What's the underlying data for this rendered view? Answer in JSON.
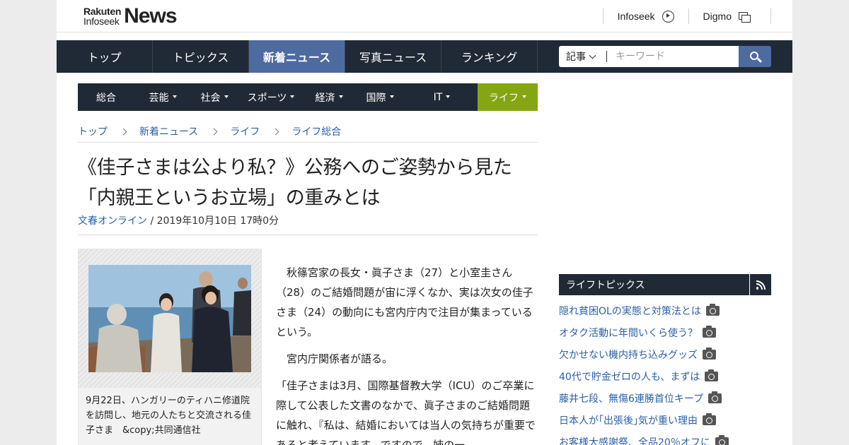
{
  "header": {
    "logo_small_1": "Rakuten",
    "logo_small_2": "Infoseek",
    "logo_big": "News",
    "links": [
      {
        "label": "Infoseek",
        "icon": "circle-arrow-icon"
      },
      {
        "label": "Digmo",
        "icon": "window-icon"
      }
    ]
  },
  "mainnav": {
    "items": [
      "トップ",
      "トピックス",
      "新着ニュース",
      "写真ニュース",
      "ランキング"
    ],
    "active": "新着ニュース"
  },
  "search": {
    "select_value": "記事",
    "placeholder": "キーワード"
  },
  "catnav": {
    "items": [
      "総合",
      "芸能",
      "社会",
      "スポーツ",
      "経済",
      "国際",
      "IT",
      "ライフ"
    ],
    "active": "ライフ",
    "active_color": "#85a613"
  },
  "breadcrumb": [
    "トップ",
    "新着ニュース",
    "ライフ",
    "ライフ総合"
  ],
  "article": {
    "title": "《佳子さまは公より私？》公務へのご姿勢から見た「内親王というお立場」の重みとは",
    "source": "文春オンライン",
    "date": "/ 2019年10月10日 17時0分",
    "caption": "9月22日、ハンガリーのティハニ修道院を訪問し、地元の人たちと交流される佳子さま　&copy;共同通信社",
    "paragraphs": [
      "秋篠宮家の長女・眞子さま（27）と小室圭さん（28）のご結婚問題が宙に浮くなか、実は次女の佳子さま（24）の動向にも宮内庁内で注目が集まっているという。",
      "宮内庁関係者が語る。",
      "「佳子さまは3月、国際基督教大学（ICU）のご卒業に際して公表した文書のなかで、眞子さまのご結婚問題に触れ、『私は、結婚においては当人の気持ちが重要であると考えています。ですので、姉の一"
    ]
  },
  "sidebar": {
    "title": "ライフトピックス",
    "items": [
      "隠れ貧困OLの実態と対策法とは",
      "オタク活動に年間いくら使う？",
      "欠かせない機内持ち込みグッズ",
      "40代で貯金ゼロの人も、まずは",
      "藤井七段、無傷6連勝首位キープ",
      "日本人が｢出張後｣気が重い理由",
      "お客様大感謝祭、全品20％オフに"
    ]
  },
  "colors": {
    "nav_bg": "#1f2a36",
    "nav_active": "#4d6aa1",
    "link": "#2a5fa6"
  }
}
